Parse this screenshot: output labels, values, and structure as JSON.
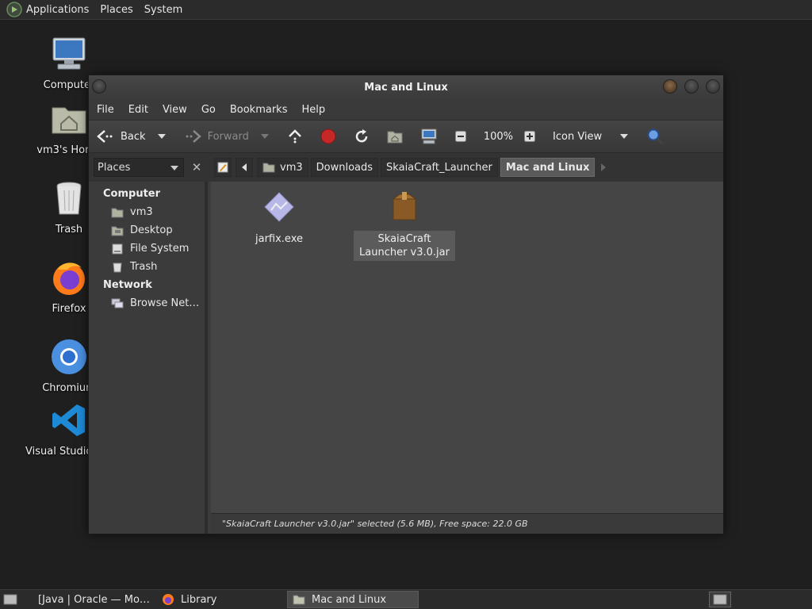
{
  "top_panel": {
    "menus": [
      "Applications",
      "Places",
      "System"
    ]
  },
  "desktop": {
    "icons": [
      {
        "label": "Computer"
      },
      {
        "label": "vm3's Home"
      },
      {
        "label": "Trash"
      },
      {
        "label": "Firefox"
      },
      {
        "label": "Chromium"
      },
      {
        "label": "Visual Studio Code"
      }
    ]
  },
  "window": {
    "title": "Mac and Linux",
    "menu": [
      "File",
      "Edit",
      "View",
      "Go",
      "Bookmarks",
      "Help"
    ],
    "toolbar": {
      "back": "Back",
      "forward": "Forward",
      "zoom": "100%",
      "view_mode": "Icon View"
    },
    "places_label": "Places",
    "breadcrumbs": [
      "vm3",
      "Downloads",
      "SkaiaCraft_Launcher",
      "Mac and Linux"
    ],
    "sidebar": {
      "computer_heading": "Computer",
      "computer_items": [
        "vm3",
        "Desktop",
        "File System",
        "Trash"
      ],
      "network_heading": "Network",
      "network_items": [
        "Browse Net…"
      ]
    },
    "files": [
      {
        "name": "jarfix.exe",
        "selected": false
      },
      {
        "name": "SkaiaCraft Launcher v3.0.jar",
        "selected": true
      }
    ],
    "status": "\"SkaiaCraft Launcher v3.0.jar\" selected (5.6 MB), Free space: 22.0 GB"
  },
  "taskbar": {
    "tasks": [
      {
        "label": "[Java | Oracle — Mo…",
        "active": false
      },
      {
        "label": "Library",
        "active": false
      },
      {
        "label": "Mac and Linux",
        "active": true
      }
    ]
  }
}
